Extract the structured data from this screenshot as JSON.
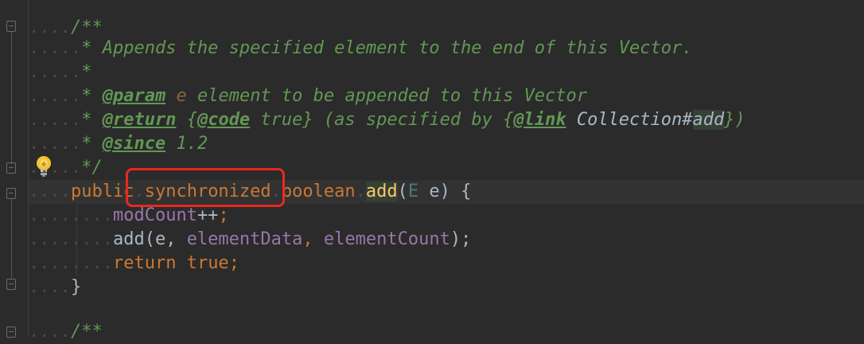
{
  "code": {
    "doc_open": "/**",
    "doc_line1": "* Appends the specified element to the end of this Vector.",
    "doc_star": "*",
    "param_star": "* ",
    "param_tag": "@param",
    "param_name": "e",
    "param_desc": " element to be appended to this Vector",
    "return_star": "* ",
    "return_tag": "@return",
    "return_brace_open": " {",
    "code_tag": "@code",
    "return_true": " true}",
    "return_mid": " (as specified by ",
    "link_brace_open": "{",
    "link_tag": "@link",
    "link_class": " Collection#",
    "link_method": "add",
    "link_close": "})",
    "since_star": "* ",
    "since_tag": "@since",
    "since_value": " 1.2",
    "doc_close": "*/",
    "kw_public": "public",
    "kw_synchronized": "synchronized",
    "kw_boolean": "boolean",
    "method_name": "add",
    "paren_open": "(",
    "type_param": "E",
    "param_e": " e",
    "sig_close": ") {",
    "modcount": "modCount",
    "modcount_op": "++",
    "semicolon": ";",
    "call_add": "add(e, ",
    "element_data": "elementData",
    "comma": ", ",
    "element_count": "elementCount",
    "call_close": ");",
    "kw_return": "return",
    "kw_true": " true",
    "close_brace": "}",
    "next_doc_open": "/**"
  },
  "colors": {
    "background": "#2b2b2b",
    "keyword": "#cc7832",
    "doc_comment": "#629755",
    "method": "#ffc66d",
    "field": "#9876aa",
    "annotation_box": "#e8281f"
  },
  "icons": [
    "fold-icon",
    "lightbulb-icon"
  ]
}
